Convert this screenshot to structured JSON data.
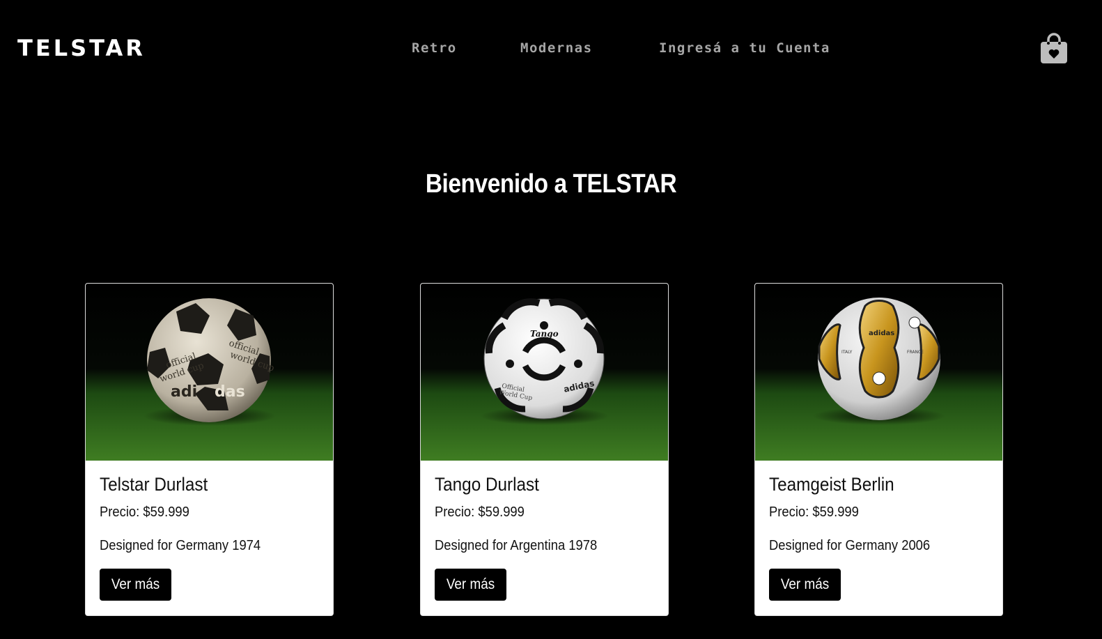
{
  "brand": "TELSTAR",
  "nav": {
    "retro": "Retro",
    "modernas": "Modernas",
    "cuenta": "Ingresá a tu Cuenta"
  },
  "cart_icon": "shopping-bag-heart-icon",
  "hero": {
    "title": "Bienvenido a TELSTAR"
  },
  "products": [
    {
      "name": "Telstar Durlast",
      "price": "Precio: $59.999",
      "description": "Designed for Germany 1974",
      "button": "Ver más",
      "ball_style": "telstar-1974"
    },
    {
      "name": "Tango Durlast",
      "price": "Precio: $59.999",
      "description": "Designed for Argentina 1978",
      "button": "Ver más",
      "ball_style": "tango-1978"
    },
    {
      "name": "Teamgeist Berlin",
      "price": "Precio: $59.999",
      "description": "Designed for Germany 2006",
      "button": "Ver más",
      "ball_style": "teamgeist-2006"
    }
  ],
  "colors": {
    "background": "#000000",
    "nav_link": "#a6a6a6",
    "card_bg": "#ffffff",
    "button_bg": "#000000",
    "grass": "#2f6a1a"
  }
}
